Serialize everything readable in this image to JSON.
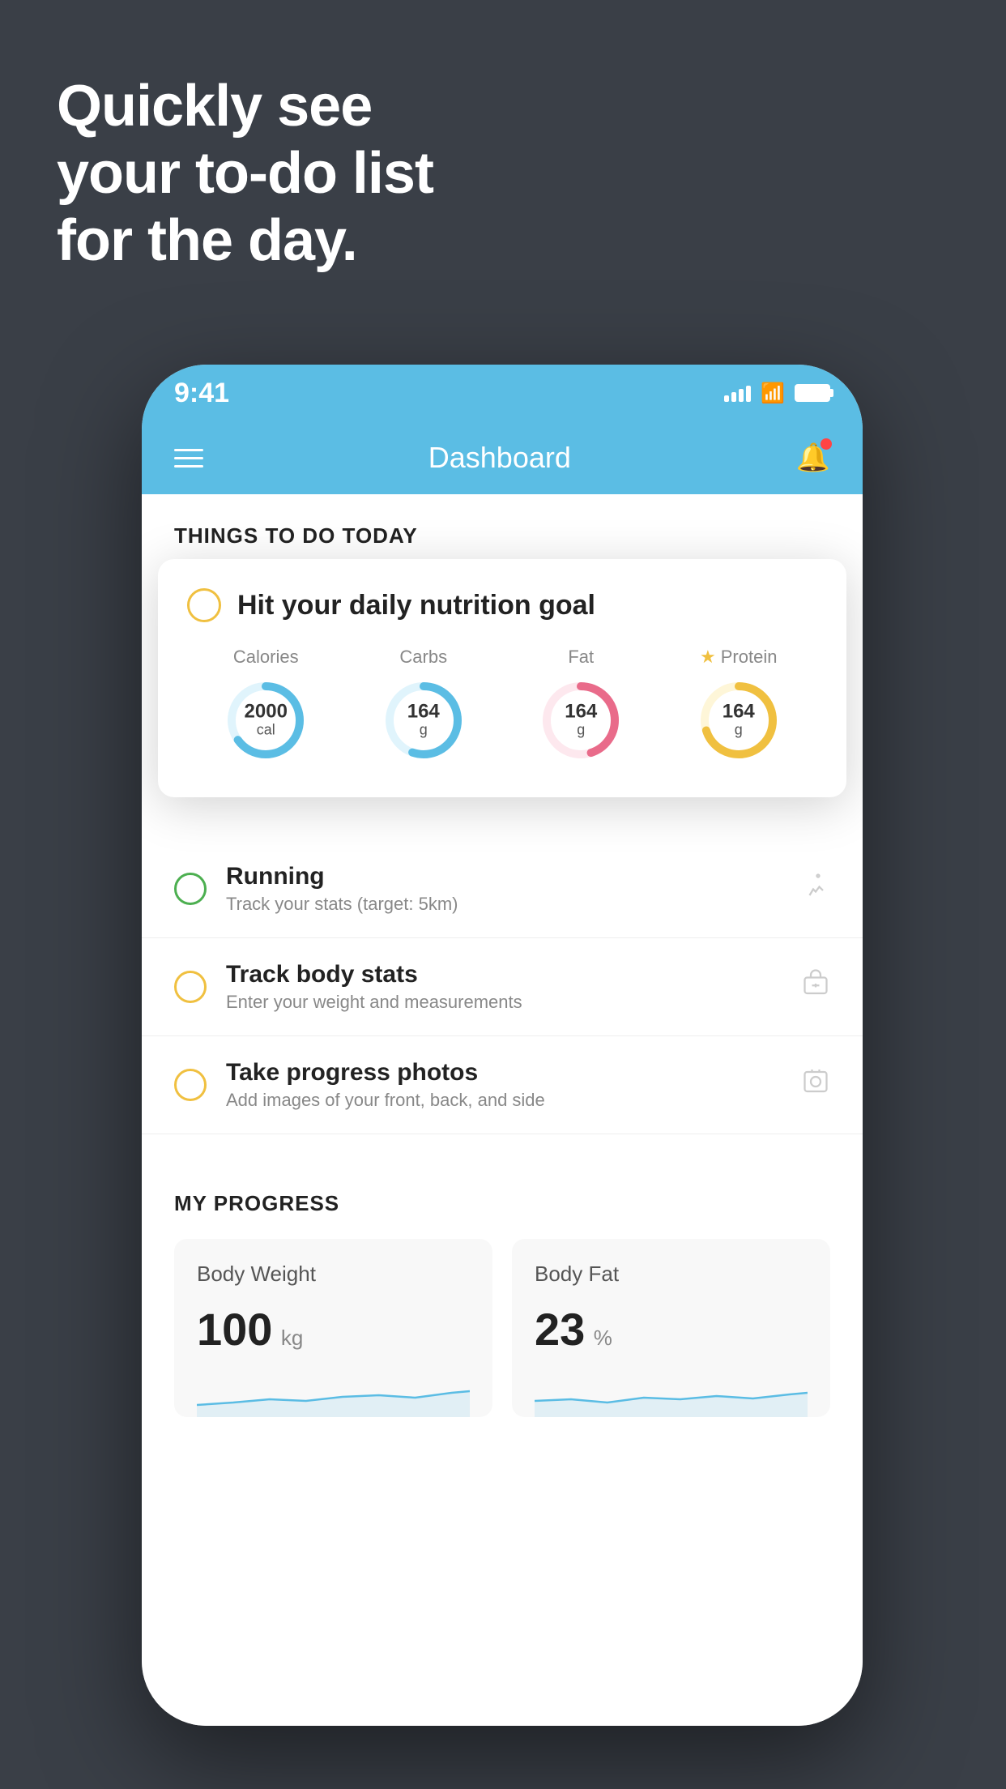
{
  "headline": {
    "line1": "Quickly see",
    "line2": "your to-do list",
    "line3": "for the day."
  },
  "status_bar": {
    "time": "9:41"
  },
  "header": {
    "title": "Dashboard"
  },
  "section_today": {
    "label": "THINGS TO DO TODAY"
  },
  "floating_card": {
    "title": "Hit your daily nutrition goal",
    "nutrition": [
      {
        "label": "Calories",
        "value": "2000",
        "unit": "cal",
        "color": "#5bbde4",
        "track_color": "#e0f4fc",
        "percent": 0.65
      },
      {
        "label": "Carbs",
        "value": "164",
        "unit": "g",
        "color": "#5bbde4",
        "track_color": "#e0f4fc",
        "percent": 0.55
      },
      {
        "label": "Fat",
        "value": "164",
        "unit": "g",
        "color": "#e96b8a",
        "track_color": "#fde8ee",
        "percent": 0.45
      },
      {
        "label": "Protein",
        "value": "164",
        "unit": "g",
        "color": "#f0c040",
        "track_color": "#fef6d8",
        "percent": 0.7,
        "starred": true
      }
    ]
  },
  "todo_items": [
    {
      "name": "Running",
      "sub": "Track your stats (target: 5km)",
      "circle_color": "green",
      "icon": "🥾"
    },
    {
      "name": "Track body stats",
      "sub": "Enter your weight and measurements",
      "circle_color": "yellow",
      "icon": "⚖"
    },
    {
      "name": "Take progress photos",
      "sub": "Add images of your front, back, and side",
      "circle_color": "yellow",
      "icon": "👤"
    }
  ],
  "progress_section": {
    "label": "MY PROGRESS",
    "cards": [
      {
        "title": "Body Weight",
        "value": "100",
        "unit": "kg"
      },
      {
        "title": "Body Fat",
        "value": "23",
        "unit": "%"
      }
    ]
  }
}
